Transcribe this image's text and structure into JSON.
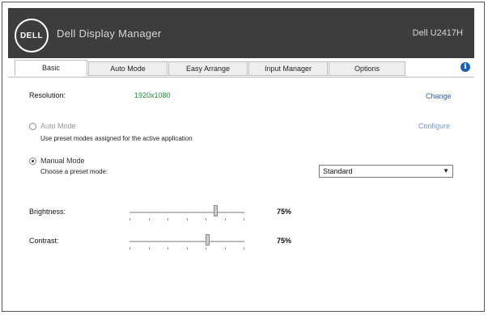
{
  "app": {
    "logo_text": "DELL",
    "title": "Dell Display Manager",
    "model": "Dell U2417H"
  },
  "tabs": [
    {
      "label": "Basic"
    },
    {
      "label": "Auto Mode"
    },
    {
      "label": "Easy Arrange"
    },
    {
      "label": "Input Manager"
    },
    {
      "label": "Options"
    }
  ],
  "info_icon": "info-icon",
  "basic": {
    "resolution_label": "Resolution:",
    "resolution_value": "1920x1080",
    "change_link": "Change",
    "auto_mode_label": "Auto Mode",
    "auto_mode_desc": "Use preset modes assigned for the active application",
    "configure_link": "Configure",
    "manual_mode_label": "Manual Mode",
    "manual_mode_desc": "Choose a preset mode:",
    "preset_value": "Standard",
    "auto_mode_selected": false,
    "manual_mode_selected": true
  },
  "sliders": {
    "brightness": {
      "label": "Brightness:",
      "value_text": "75%",
      "value": 0.75
    },
    "contrast": {
      "label": "Contrast:",
      "value_text": "75%",
      "value": 0.68
    }
  }
}
